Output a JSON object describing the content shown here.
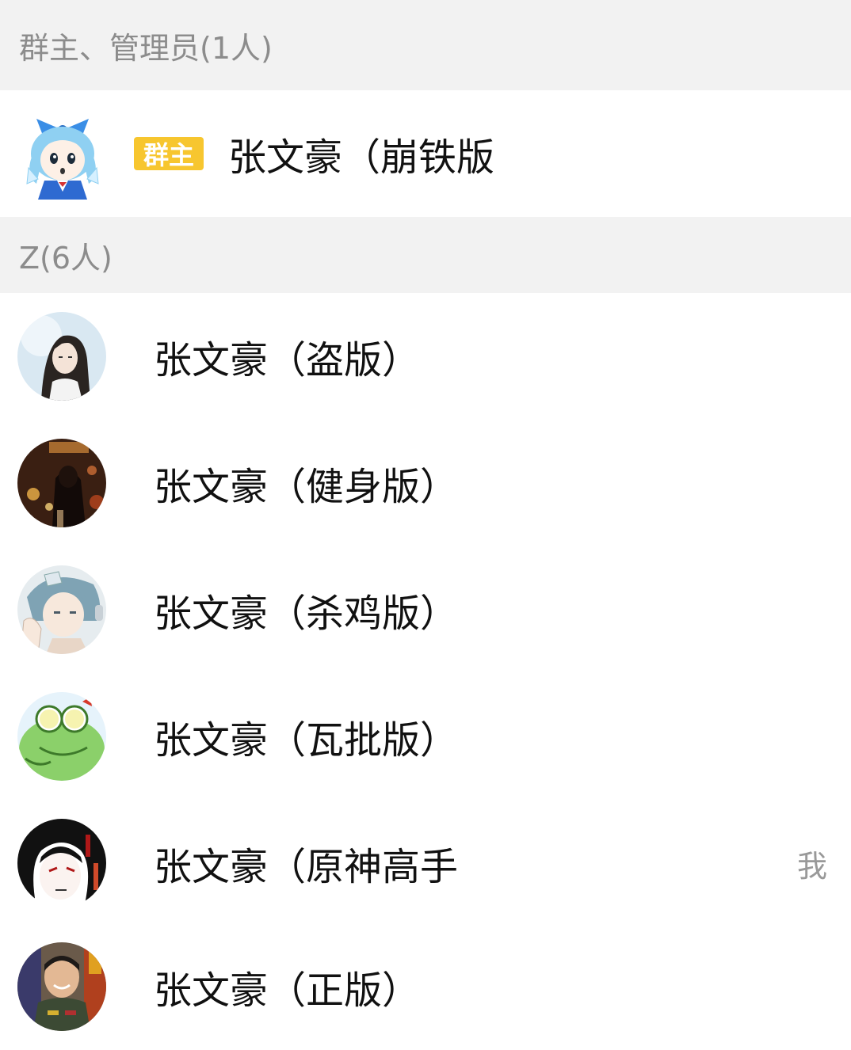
{
  "sections": {
    "admins": {
      "header": "群主、管理员(1人)",
      "owner": {
        "badge": "群主",
        "name": "张文豪（崩铁版",
        "avatar_icon": "cirno-avatar-icon"
      }
    },
    "z": {
      "header": "Z(6人)",
      "members": [
        {
          "name": "张文豪（盗版）",
          "avatar_icon": "longhair-character-avatar-icon"
        },
        {
          "name": "张文豪（健身版）",
          "avatar_icon": "night-street-avatar-icon"
        },
        {
          "name": "张文豪（杀鸡版）",
          "avatar_icon": "anime-boy-avatar-icon"
        },
        {
          "name": "张文豪（瓦批版）",
          "avatar_icon": "frog-avatar-icon"
        },
        {
          "name": "张文豪（原神高手",
          "avatar_icon": "manga-girl-avatar-icon",
          "tag": "我"
        },
        {
          "name": "张文豪（正版）",
          "avatar_icon": "soldier-avatar-icon"
        }
      ]
    }
  },
  "colors": {
    "header_bg": "#f2f2f2",
    "header_text": "#8c8c8c",
    "badge_bg": "#f7c62f",
    "name_text": "#111111",
    "tag_text": "#999999"
  }
}
